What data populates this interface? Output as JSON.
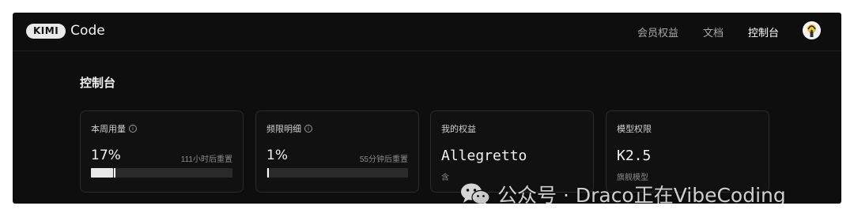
{
  "brand": {
    "logo_pill": "KIMI",
    "logo_text": "Code"
  },
  "nav": {
    "items": [
      {
        "label": "会员权益",
        "active": false
      },
      {
        "label": "文档",
        "active": false
      },
      {
        "label": "控制台",
        "active": true
      }
    ],
    "avatar_icon": "avatar-icon"
  },
  "page": {
    "title": "控制台"
  },
  "cards": [
    {
      "label": "本周用量",
      "info_icon": "ⓘ",
      "value": "17%",
      "reset": "111小时后重置",
      "progress": 0.17
    },
    {
      "label": "频限明细",
      "info_icon": "ⓘ",
      "value": "1%",
      "reset": "55分钟后重置",
      "progress": 0.01
    },
    {
      "label": "我的权益",
      "value": "Allegretto",
      "sub": "含"
    },
    {
      "label": "模型权限",
      "value": "K2.5",
      "sub": "旗舰模型"
    }
  ],
  "watermark": {
    "text": "公众号 · Draco正在VibeCoding",
    "icon": "wechat-icon"
  },
  "colors": {
    "background": "#0e0e0e",
    "card_border": "#2b2b2b",
    "progress_fill": "#e8e8e8",
    "progress_track": "#2a2a2a"
  }
}
